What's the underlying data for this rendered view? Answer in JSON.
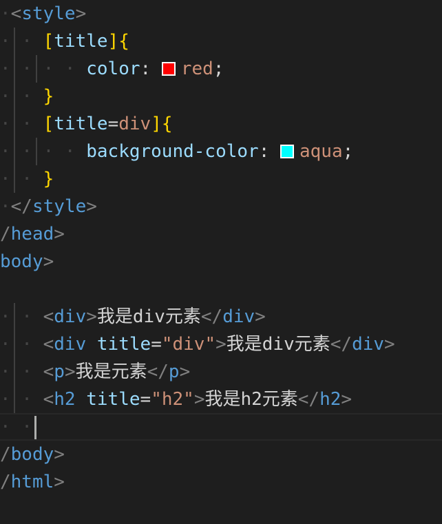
{
  "editor": {
    "colors": {
      "background": "#1e1e1e",
      "tag": "#569cd6",
      "bracket": "#808080",
      "attribute": "#9cdcfe",
      "string": "#ce9178",
      "text": "#d4d4d4",
      "brace": "#ffd700",
      "red_swatch": "#ff0000",
      "aqua_swatch": "#00ffff"
    },
    "lines": [
      {
        "indent": "·",
        "guides": [],
        "tokens": [
          {
            "t": "<",
            "c": "bracket"
          },
          {
            "t": "style",
            "c": "tag"
          },
          {
            "t": ">",
            "c": "bracket"
          }
        ]
      },
      {
        "indent": "· · ",
        "guides": [
          1
        ],
        "tokens": [
          {
            "t": "[",
            "c": "brace"
          },
          {
            "t": "title",
            "c": "attr"
          },
          {
            "t": "]",
            "c": "brace"
          },
          {
            "t": "{",
            "c": "brace"
          }
        ]
      },
      {
        "indent": "· · · · ",
        "guides": [
          1,
          2
        ],
        "tokens": [
          {
            "t": "color",
            "c": "attr"
          },
          {
            "t": ": ",
            "c": "punc"
          },
          {
            "swatch": "#ff0000",
            "name": "red-color-swatch"
          },
          {
            "t": "red",
            "c": "str"
          },
          {
            "t": ";",
            "c": "punc"
          }
        ]
      },
      {
        "indent": "· · ",
        "guides": [
          1
        ],
        "tokens": [
          {
            "t": "}",
            "c": "brace"
          }
        ]
      },
      {
        "indent": "· · ",
        "guides": [
          1
        ],
        "tokens": [
          {
            "t": "[",
            "c": "brace"
          },
          {
            "t": "title",
            "c": "attr"
          },
          {
            "t": "=",
            "c": "punc"
          },
          {
            "t": "div",
            "c": "str"
          },
          {
            "t": "]",
            "c": "brace"
          },
          {
            "t": "{",
            "c": "brace"
          }
        ]
      },
      {
        "indent": "· · · · ",
        "guides": [
          1,
          2
        ],
        "tokens": [
          {
            "t": "background-color",
            "c": "attr"
          },
          {
            "t": ": ",
            "c": "punc"
          },
          {
            "swatch": "#00ffff",
            "name": "aqua-color-swatch"
          },
          {
            "t": "aqua",
            "c": "str"
          },
          {
            "t": ";",
            "c": "punc"
          }
        ]
      },
      {
        "indent": "· · ",
        "guides": [
          1
        ],
        "tokens": [
          {
            "t": "}",
            "c": "brace"
          }
        ]
      },
      {
        "indent": "·",
        "guides": [],
        "tokens": [
          {
            "t": "</",
            "c": "bracket"
          },
          {
            "t": "style",
            "c": "tag"
          },
          {
            "t": ">",
            "c": "bracket"
          }
        ]
      },
      {
        "indent": "",
        "guides": [],
        "tokens": [
          {
            "t": "/",
            "c": "bracket"
          },
          {
            "t": "head",
            "c": "tag"
          },
          {
            "t": ">",
            "c": "bracket"
          }
        ]
      },
      {
        "indent": "",
        "guides": [],
        "tokens": [
          {
            "t": "body",
            "c": "tag"
          },
          {
            "t": ">",
            "c": "bracket"
          }
        ]
      },
      {
        "indent": "",
        "guides": [],
        "tokens": []
      },
      {
        "indent": "· · ",
        "guides": [
          1
        ],
        "tokens": [
          {
            "t": "<",
            "c": "bracket"
          },
          {
            "t": "div",
            "c": "tag"
          },
          {
            "t": ">",
            "c": "bracket"
          },
          {
            "t": "我是div元素",
            "c": "text"
          },
          {
            "t": "</",
            "c": "bracket"
          },
          {
            "t": "div",
            "c": "tag"
          },
          {
            "t": ">",
            "c": "bracket"
          }
        ]
      },
      {
        "indent": "· · ",
        "guides": [
          1
        ],
        "tokens": [
          {
            "t": "<",
            "c": "bracket"
          },
          {
            "t": "div",
            "c": "tag"
          },
          {
            "t": " ",
            "c": "punc"
          },
          {
            "t": "title",
            "c": "attr"
          },
          {
            "t": "=",
            "c": "punc"
          },
          {
            "t": "\"div\"",
            "c": "str"
          },
          {
            "t": ">",
            "c": "bracket"
          },
          {
            "t": "我是div元素",
            "c": "text"
          },
          {
            "t": "</",
            "c": "bracket"
          },
          {
            "t": "div",
            "c": "tag"
          },
          {
            "t": ">",
            "c": "bracket"
          }
        ]
      },
      {
        "indent": "· · ",
        "guides": [
          1
        ],
        "tokens": [
          {
            "t": "<",
            "c": "bracket"
          },
          {
            "t": "p",
            "c": "tag"
          },
          {
            "t": ">",
            "c": "bracket"
          },
          {
            "t": "我是元素",
            "c": "text"
          },
          {
            "t": "</",
            "c": "bracket"
          },
          {
            "t": "p",
            "c": "tag"
          },
          {
            "t": ">",
            "c": "bracket"
          }
        ]
      },
      {
        "indent": "· · ",
        "guides": [
          1
        ],
        "tokens": [
          {
            "t": "<",
            "c": "bracket"
          },
          {
            "t": "h2",
            "c": "tag"
          },
          {
            "t": " ",
            "c": "punc"
          },
          {
            "t": "title",
            "c": "attr"
          },
          {
            "t": "=",
            "c": "punc"
          },
          {
            "t": "\"h2\"",
            "c": "str"
          },
          {
            "t": ">",
            "c": "bracket"
          },
          {
            "t": "我是h2元素",
            "c": "text"
          },
          {
            "t": "</",
            "c": "bracket"
          },
          {
            "t": "h2",
            "c": "tag"
          },
          {
            "t": ">",
            "c": "bracket"
          }
        ]
      },
      {
        "indent": "· · ",
        "guides": [],
        "current": true,
        "tokens": []
      },
      {
        "indent": "",
        "guides": [],
        "tokens": [
          {
            "t": "/",
            "c": "bracket"
          },
          {
            "t": "body",
            "c": "tag"
          },
          {
            "t": ">",
            "c": "bracket"
          }
        ]
      },
      {
        "indent": "",
        "guides": [],
        "tokens": [
          {
            "t": "/",
            "c": "bracket"
          },
          {
            "t": "html",
            "c": "tag"
          },
          {
            "t": ">",
            "c": "bracket"
          }
        ]
      }
    ]
  }
}
